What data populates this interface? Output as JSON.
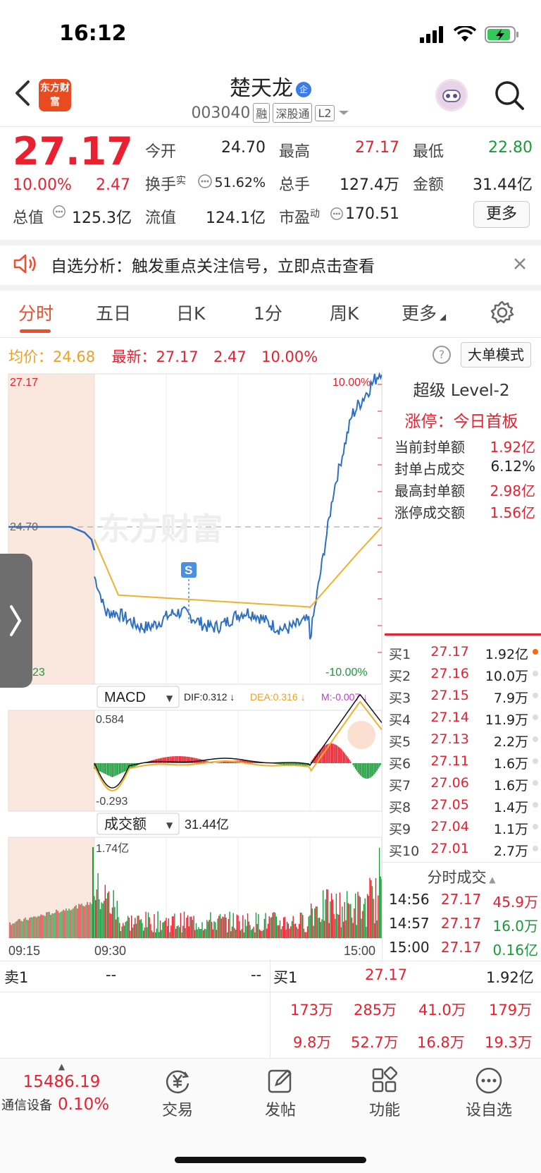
{
  "status_bar": {
    "time": "16:12"
  },
  "header": {
    "logo_text": "东方财富",
    "stock_name": "楚天龙",
    "badge": "企",
    "stock_code": "003040",
    "tags": [
      "融",
      "深股通",
      "L2"
    ]
  },
  "quote": {
    "price": "27.17",
    "change_pct": "10.00%",
    "change": "2.47",
    "fields": [
      {
        "label": "今开",
        "value": "24.70",
        "color": "dark"
      },
      {
        "label": "最高",
        "value": "27.17",
        "color": "red"
      },
      {
        "label": "最低",
        "value": "22.80",
        "color": "green"
      },
      {
        "label": "换手",
        "value": "51.62%",
        "color": "dark",
        "sup": "实"
      },
      {
        "label": "总手",
        "value": "127.4万",
        "color": "dark"
      },
      {
        "label": "金额",
        "value": "31.44亿",
        "color": "dark"
      },
      {
        "label": "总值",
        "value": "125.3亿",
        "color": "dark"
      },
      {
        "label": "流值",
        "value": "124.1亿",
        "color": "dark"
      },
      {
        "label": "市盈",
        "value": "170.51",
        "color": "dark",
        "sup": "动"
      }
    ],
    "more_label": "更多"
  },
  "notice": {
    "text": "自选分析：触发重点关注信号，立即点击查看"
  },
  "tabs": [
    "分时",
    "五日",
    "日K",
    "1分",
    "周K",
    "更多"
  ],
  "avg_row": {
    "avg_label": "均价：",
    "avg_value": "24.68",
    "latest_label": "最新：",
    "latest_value": "27.17",
    "latest_change": "2.47",
    "latest_pct": "10.00%",
    "big_order_label": "大单模式"
  },
  "chart_data": {
    "type": "line",
    "price_axis": {
      "top": "27.17",
      "base": "24.70",
      "bottom_partial": "23",
      "top_pct": "10.00%",
      "bottom_pct": "-10.00%"
    },
    "watermark": "东方财富",
    "signal_marker": "S",
    "x_labels": [
      "09:15",
      "09:30",
      "15:00"
    ],
    "macd": {
      "label": "MACD",
      "dif": "DIF:0.312 ↓",
      "dea": "DEA:0.316 ↓",
      "m": "M:-0.007 ↓",
      "top": "0.584",
      "bottom": "-0.293"
    },
    "turnover": {
      "label": "成交额",
      "total": "31.44亿",
      "top": "1.74亿"
    }
  },
  "level2": {
    "title": "超级 Level-2",
    "limit_status": "涨停：今日首板",
    "stats": [
      {
        "label": "当前封单额",
        "value": "1.92亿",
        "color": "red"
      },
      {
        "label": "封单占成交",
        "value": "6.12%",
        "color": "dark"
      },
      {
        "label": "最高封单额",
        "value": "2.98亿",
        "color": "red"
      },
      {
        "label": "涨停成交额",
        "value": "1.56亿",
        "color": "red"
      }
    ],
    "bids": [
      {
        "label": "买1",
        "price": "27.17",
        "vol": "1.92亿"
      },
      {
        "label": "买2",
        "price": "27.16",
        "vol": "10.0万"
      },
      {
        "label": "买3",
        "price": "27.15",
        "vol": "7.9万"
      },
      {
        "label": "买4",
        "price": "27.14",
        "vol": "11.9万"
      },
      {
        "label": "买5",
        "price": "27.13",
        "vol": "2.2万"
      },
      {
        "label": "买6",
        "price": "27.11",
        "vol": "1.6万"
      },
      {
        "label": "买7",
        "price": "27.06",
        "vol": "1.6万"
      },
      {
        "label": "买8",
        "price": "27.05",
        "vol": "1.4万"
      },
      {
        "label": "买9",
        "price": "27.04",
        "vol": "1.1万"
      },
      {
        "label": "买10",
        "price": "27.01",
        "vol": "2.7万"
      }
    ],
    "ticks_title": "分时成交",
    "ticks": [
      {
        "time": "14:56",
        "price": "27.17",
        "vol": "45.9万"
      },
      {
        "time": "14:57",
        "price": "27.17",
        "vol": "16.0万"
      },
      {
        "time": "15:00",
        "price": "27.17",
        "vol": "0.16亿"
      }
    ]
  },
  "orderbook": {
    "sell1_label": "卖1",
    "sell1_price": "--",
    "sell1_vol": "--",
    "buy1_label": "买1",
    "buy1_price": "27.17",
    "buy1_vol": "1.92亿",
    "row2": [
      "173万",
      "285万",
      "41.0万",
      "179万"
    ],
    "row3": [
      "9.8万",
      "52.7万",
      "16.8万",
      "19.3万"
    ]
  },
  "bottom_nav": {
    "index_value": "15486.19",
    "index_name": "通信设备",
    "index_pct": "0.10%",
    "items": [
      "交易",
      "发帖",
      "功能",
      "设自选"
    ]
  }
}
